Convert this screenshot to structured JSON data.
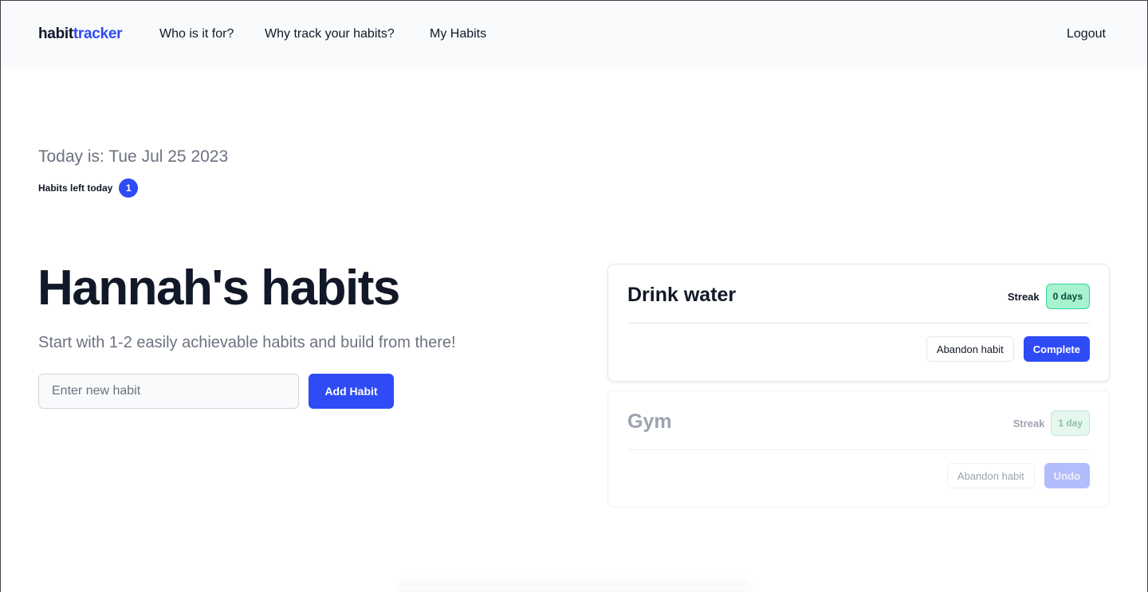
{
  "nav": {
    "brand_part1": "habit",
    "brand_part2": "tracker",
    "links": [
      {
        "label": "Who is it for?"
      },
      {
        "label": "Why track your habits?"
      },
      {
        "label": "My Habits"
      }
    ],
    "logout_label": "Logout"
  },
  "status": {
    "today_text": "Today is: Tue Jul 25 2023",
    "habits_left_label": "Habits left today",
    "habits_left_count": "1"
  },
  "hero": {
    "title": "Hannah's habits",
    "subtitle": "Start with 1-2 easily achievable habits and build from there!",
    "input_placeholder": "Enter new habit",
    "add_button_label": "Add Habit"
  },
  "habits": [
    {
      "name": "Drink water",
      "streak_label": "Streak",
      "streak_value": "0 days",
      "abandon_label": "Abandon habit",
      "action_label": "Complete",
      "completed": false
    },
    {
      "name": "Gym",
      "streak_label": "Streak",
      "streak_value": "1 day",
      "abandon_label": "Abandon habit",
      "action_label": "Undo",
      "completed": true
    }
  ],
  "colors": {
    "accent": "#2f4bf5",
    "streak_badge": "#a7f3d0",
    "nav_background": "#f8fafc"
  }
}
